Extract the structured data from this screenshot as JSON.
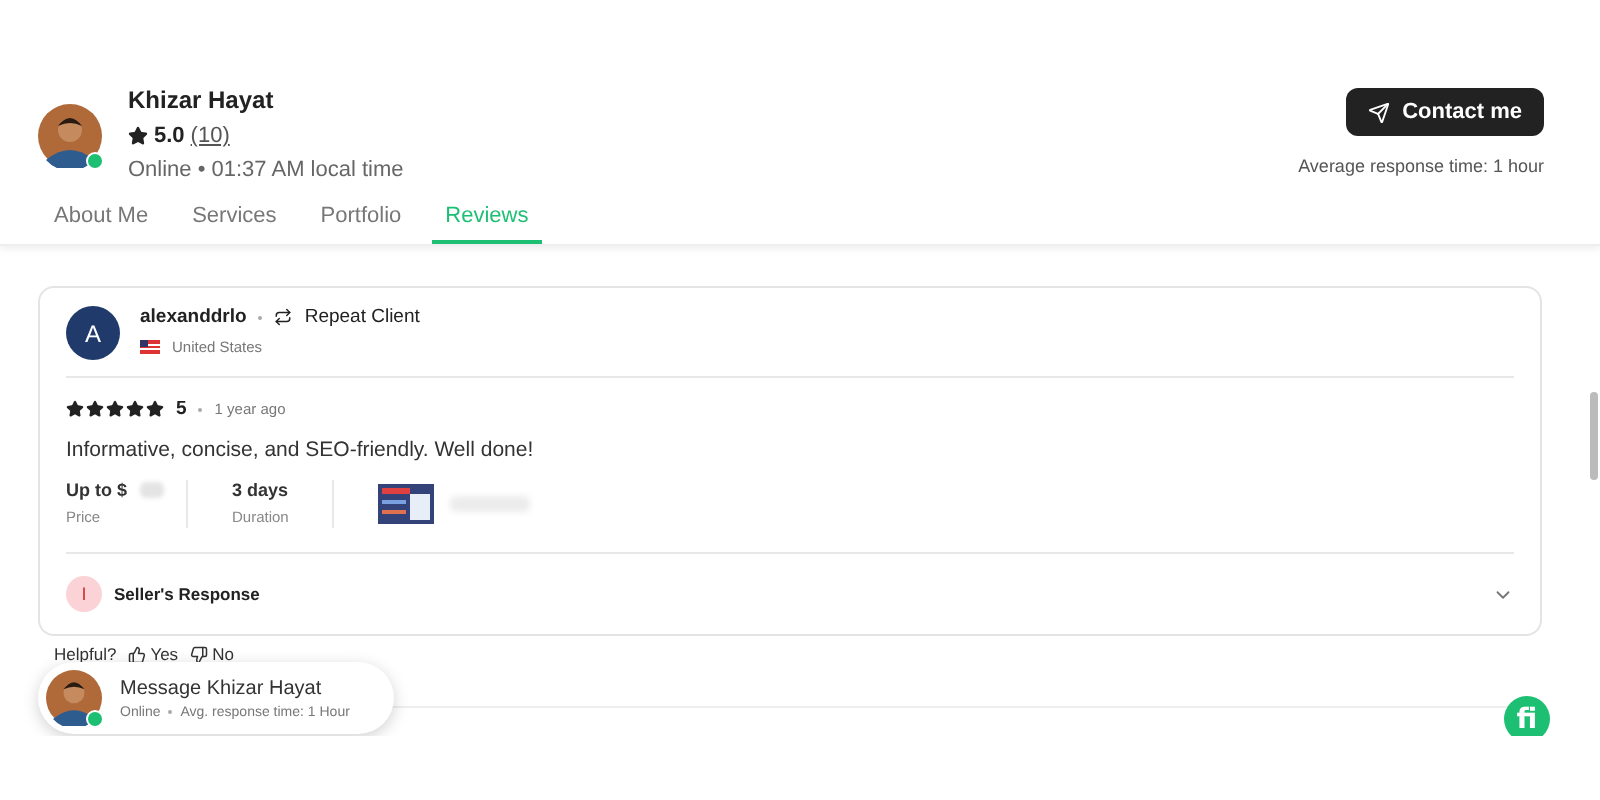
{
  "profile": {
    "name": "Khizar Hayat",
    "online": true,
    "rating": "5.0",
    "review_count": "(10)",
    "status": "Online • 01:37 AM local time"
  },
  "contact": {
    "label": "Contact me",
    "response": "Average response time: 1 hour"
  },
  "tabs": [
    {
      "label": "About Me",
      "selected": false
    },
    {
      "label": "Services",
      "selected": false
    },
    {
      "label": "Portfolio",
      "selected": false
    },
    {
      "label": "Reviews",
      "selected": true
    }
  ],
  "review": {
    "initial": "A",
    "user": "alexanddrlo",
    "badge": "Repeat Client",
    "country": "United States",
    "stars": 5,
    "score": "5",
    "time": "1 year ago",
    "text": "Informative, concise, and SEO-friendly. Well done!",
    "facts": [
      {
        "value": "Up to $",
        "label": "Price"
      },
      {
        "value": "3 days",
        "label": "Duration"
      }
    ],
    "response": {
      "initial": "I",
      "label": "Seller's Response",
      "expanded": false
    }
  },
  "helpful": {
    "label": "Helpful?",
    "yes": "Yes",
    "no": "No"
  },
  "chat": {
    "title": "Message Khizar Hayat",
    "status": "Online",
    "response": "Avg. response time: 1 Hour",
    "online": true
  },
  "logo": "fi"
}
